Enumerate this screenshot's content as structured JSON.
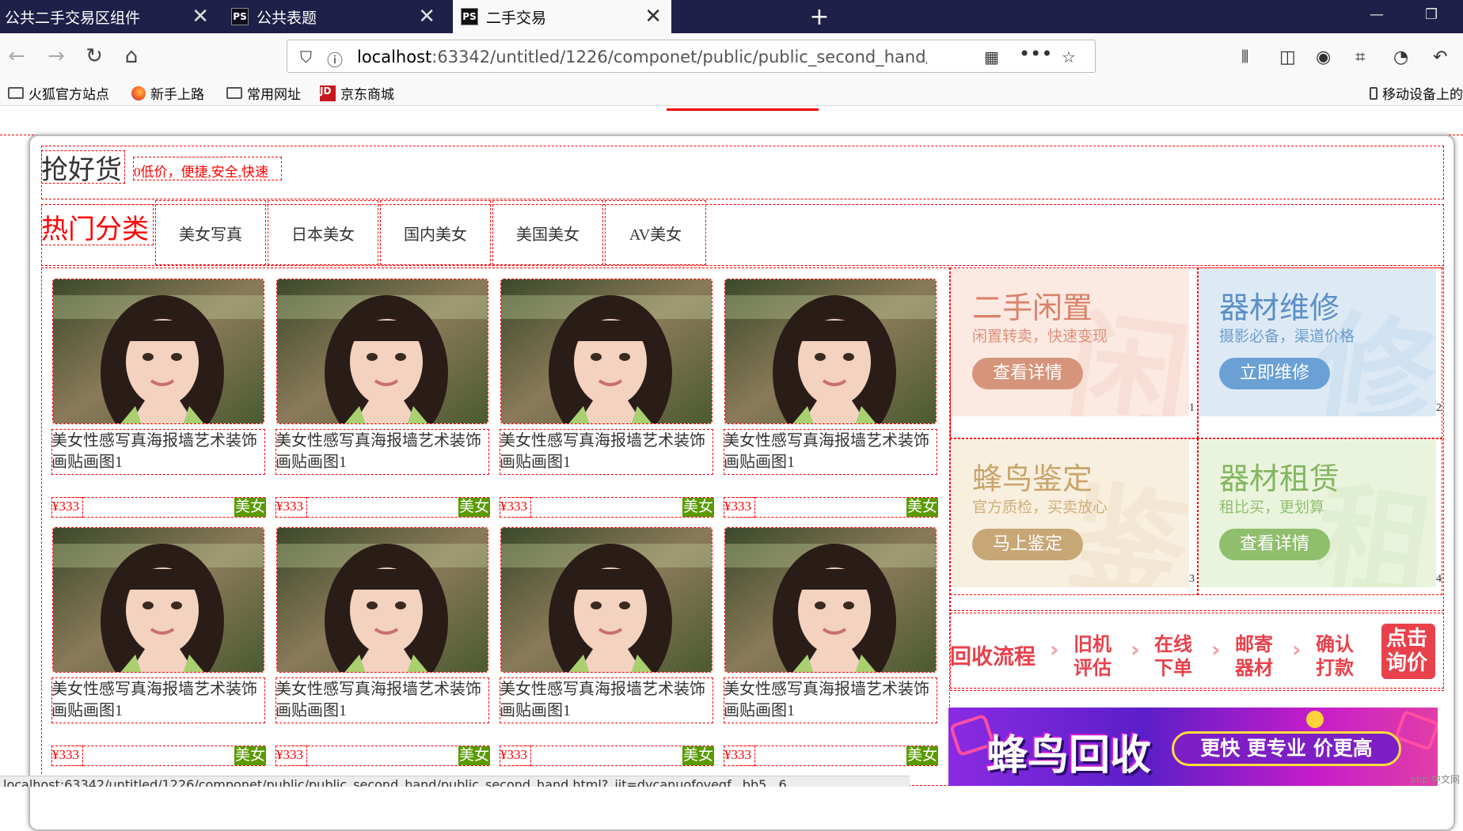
{
  "browser": {
    "tabs": [
      {
        "label": "公共二手交易区组件",
        "icon": "",
        "close": "✕"
      },
      {
        "label": "公共表题",
        "icon": "PS",
        "close": "✕"
      },
      {
        "label": "二手交易",
        "icon": "PS",
        "close": "✕"
      }
    ],
    "new_tab": "+",
    "url_host": "localhost",
    "url_rest": ":63342/untitled/1226/componet/public/public_second_hand/public",
    "bookmarks": [
      {
        "label": "火狐官方站点",
        "icon": "folder-icon"
      },
      {
        "label": "新手上路",
        "icon": "firefox-icon"
      },
      {
        "label": "常用网址",
        "icon": "folder-icon"
      },
      {
        "label": "京东商城",
        "icon": "jd-icon"
      }
    ],
    "jd_icon_text": "JD",
    "mobile_bookmark": "移动设备上的",
    "status_url": "localhost:63342/untitled/1226/componet/public/public_second_hand/public_second_hand.html?_ijt=dvcanuofoveqf...bb5...6..."
  },
  "section": {
    "title": "抢好货",
    "subtitle": "0低价，便捷,安全,快速",
    "hot_label": "热门分类",
    "categories": [
      "美女写真",
      "日本美女",
      "国内美女",
      "美国美女",
      "AV美女"
    ]
  },
  "products": [
    {
      "title": "美女性感写真海报墙艺术装饰画贴画图1",
      "price": "¥333",
      "tag": "美女"
    },
    {
      "title": "美女性感写真海报墙艺术装饰画贴画图1",
      "price": "¥333",
      "tag": "美女"
    },
    {
      "title": "美女性感写真海报墙艺术装饰画贴画图1",
      "price": "¥333",
      "tag": "美女"
    },
    {
      "title": "美女性感写真海报墙艺术装饰画贴画图1",
      "price": "¥333",
      "tag": "美女"
    },
    {
      "title": "美女性感写真海报墙艺术装饰画贴画图1",
      "price": "¥333",
      "tag": "美女"
    },
    {
      "title": "美女性感写真海报墙艺术装饰画贴画图1",
      "price": "¥333",
      "tag": "美女"
    },
    {
      "title": "美女性感写真海报墙艺术装饰画贴画图1",
      "price": "¥333",
      "tag": "美女"
    },
    {
      "title": "美女性感写真海报墙艺术装饰画贴画图1",
      "price": "¥333",
      "tag": "美女"
    }
  ],
  "services": [
    {
      "title": "二手闲置",
      "desc": "闲置转卖，快速变现",
      "button": "查看详情",
      "watermark": "闲",
      "num": "1",
      "bg": "#fbe9e2",
      "fg": "#d9826a",
      "btn": "#d6957a"
    },
    {
      "title": "器材维修",
      "desc": "摄影必备，渠道价格",
      "button": "立即维修",
      "watermark": "修",
      "num": "2",
      "bg": "#ddeaf6",
      "fg": "#5b8fc6",
      "btn": "#6aa0d4"
    },
    {
      "title": "蜂鸟鉴定",
      "desc": "官方质检，买卖放心",
      "button": "马上鉴定",
      "watermark": "鉴",
      "num": "3",
      "bg": "#f8efdf",
      "fg": "#c9a46a",
      "btn": "#c7a776"
    },
    {
      "title": "器材租赁",
      "desc": "租比买，更划算",
      "button": "查看详情",
      "watermark": "租",
      "num": "4",
      "bg": "#eaf4dd",
      "fg": "#83b661",
      "btn": "#8fbf6d"
    }
  ],
  "process": {
    "label": "回收流程",
    "steps": [
      [
        "旧机",
        "评估"
      ],
      [
        "在线",
        "下单"
      ],
      [
        "邮寄",
        "器材"
      ],
      [
        "确认",
        "打款"
      ]
    ],
    "cta": [
      "点击",
      "询价"
    ]
  },
  "banner": {
    "title": "蜂鸟回收",
    "slogan": "更快 更专业 价更高"
  },
  "watermark": "php 中文网"
}
